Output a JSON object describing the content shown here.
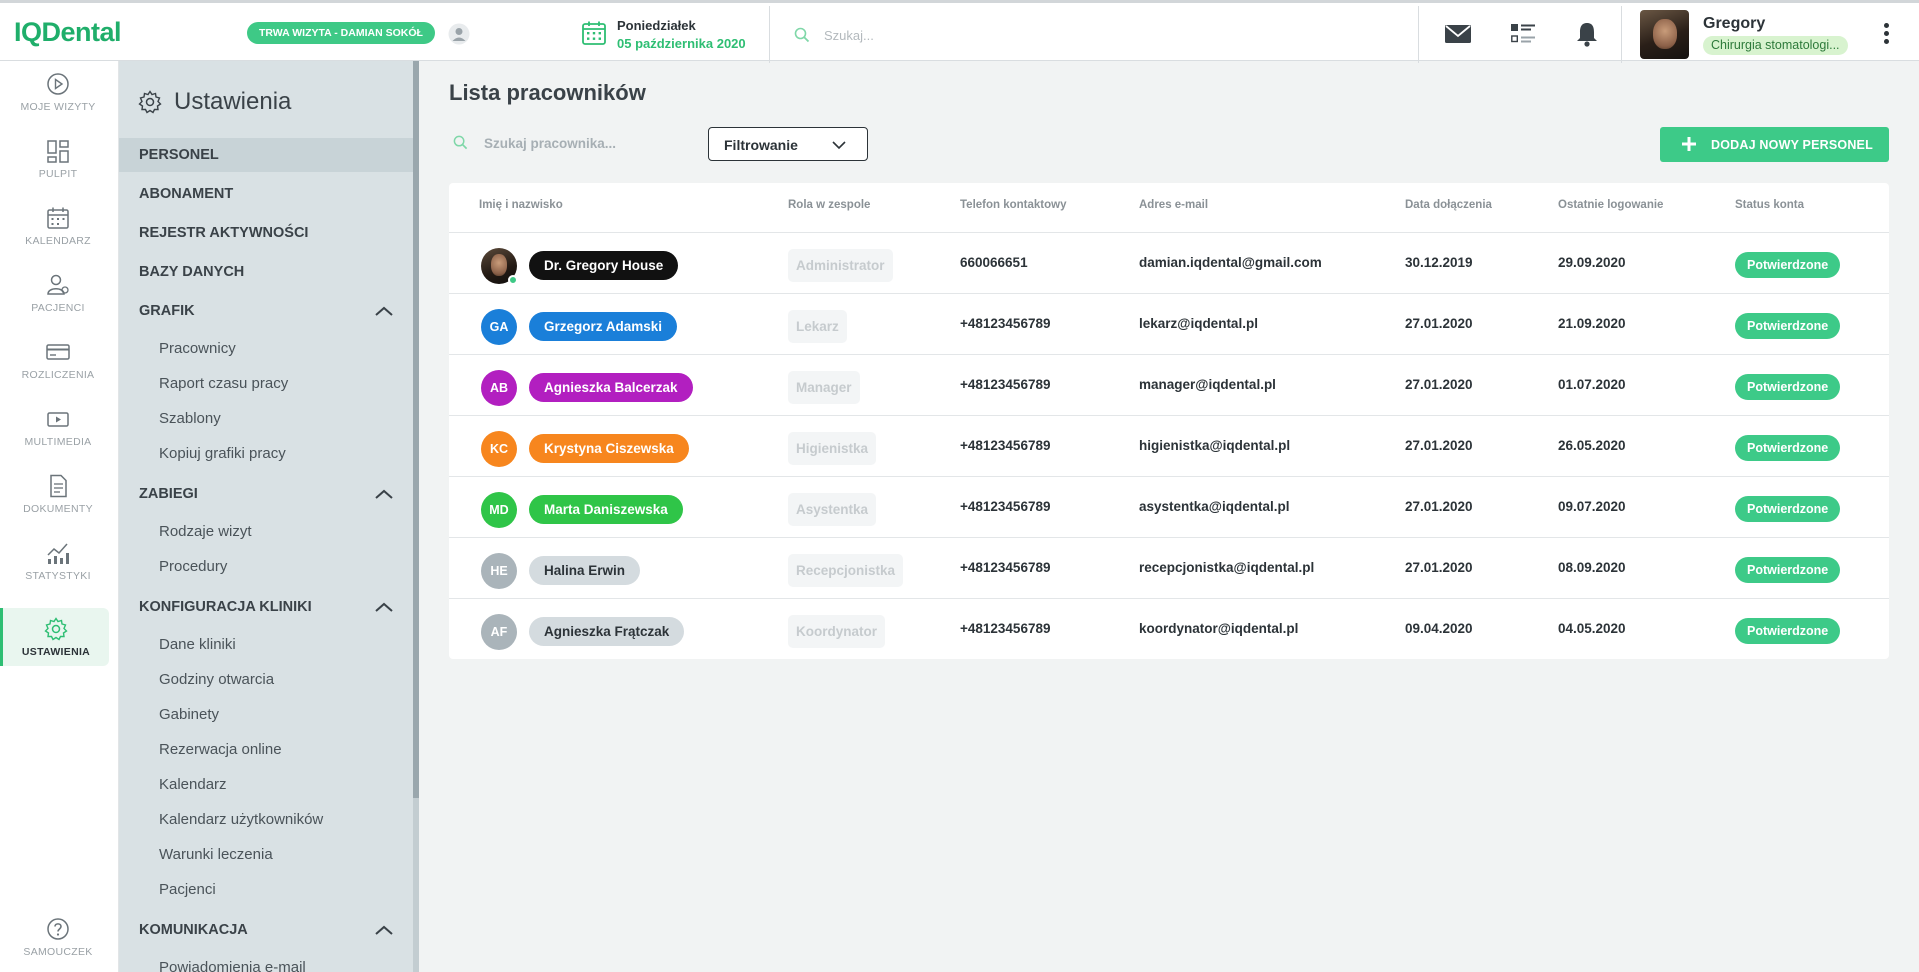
{
  "app": {
    "logo": "IQDental",
    "visit_badge": "TRWA WIZYTA - DAMIAN SOKÓŁ",
    "day_name": "Poniedziałek",
    "date": "05 października 2020",
    "search_placeholder": "Szukaj...",
    "user_name": "Gregory",
    "user_role": "Chirurgia stomatologi..."
  },
  "rail": {
    "items": [
      {
        "label": "MOJE WIZYTY",
        "icon": "play-circle-icon"
      },
      {
        "label": "PULPIT",
        "icon": "dashboard-icon"
      },
      {
        "label": "KALENDARZ",
        "icon": "calendar-icon"
      },
      {
        "label": "PACJENCI",
        "icon": "patients-icon"
      },
      {
        "label": "ROZLICZENIA",
        "icon": "credit-card-icon"
      },
      {
        "label": "MULTIMEDIA",
        "icon": "media-icon"
      },
      {
        "label": "DOKUMENTY",
        "icon": "document-icon"
      },
      {
        "label": "STATYSTYKI",
        "icon": "stats-icon"
      },
      {
        "label": "USTAWIENIA",
        "icon": "gear-icon",
        "active": true
      }
    ],
    "help_label": "SAMOUCZEK"
  },
  "settings": {
    "title": "Ustawienia",
    "sections": {
      "personel": "PERSONEL",
      "abonament": "ABONAMENT",
      "rejestr": "REJESTR AKTYWNOŚCI",
      "bazy": "BAZY DANYCH",
      "grafik": "GRAFIK",
      "zabiegi": "ZABIEGI",
      "konfiguracja": "KONFIGURACJA KLINIKI",
      "komunikacja": "KOMUNIKACJA"
    },
    "grafik_items": [
      "Pracownicy",
      "Raport czasu pracy",
      "Szablony",
      "Kopiuj grafiki pracy"
    ],
    "zabiegi_items": [
      "Rodzaje wizyt",
      "Procedury"
    ],
    "konfiguracja_items": [
      "Dane kliniki",
      "Godziny otwarcia",
      "Gabinety",
      "Rezerwacja online",
      "Kalendarz",
      "Kalendarz użytkowników",
      "Warunki leczenia",
      "Pacjenci"
    ],
    "komunikacja_items": [
      "Powiadomienia e-mail"
    ]
  },
  "main": {
    "title": "Lista pracowników",
    "search_placeholder": "Szukaj pracownika...",
    "filter_label": "Filtrowanie",
    "add_button": "DODAJ NOWY PERSONEL",
    "columns": {
      "name": "Imię i nazwisko",
      "role": "Rola w zespole",
      "phone": "Telefon kontaktowy",
      "email": "Adres e-mail",
      "joined": "Data dołączenia",
      "last_login": "Ostatnie logowanie",
      "status": "Status konta"
    },
    "rows": [
      {
        "initials": "",
        "name": "Dr. Gregory House",
        "role": "Administrator",
        "phone": "660066651",
        "email": "damian.iqdental@gmail.com",
        "joined": "30.12.2019",
        "last_login": "29.09.2020",
        "status": "Potwierdzone",
        "color": "#111111",
        "text_color": "#ffffff"
      },
      {
        "initials": "GA",
        "name": "Grzegorz Adamski",
        "role": "Lekarz",
        "phone": "+48123456789",
        "email": "lekarz@iqdental.pl",
        "joined": "27.01.2020",
        "last_login": "21.09.2020",
        "status": "Potwierdzone",
        "color": "#1a7fd9",
        "text_color": "#ffffff"
      },
      {
        "initials": "AB",
        "name": "Agnieszka Balcerzak",
        "role": "Manager",
        "phone": "+48123456789",
        "email": "manager@iqdental.pl",
        "joined": "27.01.2020",
        "last_login": "01.07.2020",
        "status": "Potwierdzone",
        "color": "#b21fc0",
        "text_color": "#ffffff"
      },
      {
        "initials": "KC",
        "name": "Krystyna Ciszewska",
        "role": "Higienistka",
        "phone": "+48123456789",
        "email": "higienistka@iqdental.pl",
        "joined": "27.01.2020",
        "last_login": "26.05.2020",
        "status": "Potwierdzone",
        "color": "#f7861e",
        "text_color": "#ffffff"
      },
      {
        "initials": "MD",
        "name": "Marta Daniszewska",
        "role": "Asystentka",
        "phone": "+48123456789",
        "email": "asystentka@iqdental.pl",
        "joined": "27.01.2020",
        "last_login": "09.07.2020",
        "status": "Potwierdzone",
        "color": "#2fc548",
        "text_color": "#ffffff"
      },
      {
        "initials": "HE",
        "name": "Halina Erwin",
        "role": "Recepcjonistka",
        "phone": "+48123456789",
        "email": "recepcjonistka@iqdental.pl",
        "joined": "27.01.2020",
        "last_login": "08.09.2020",
        "status": "Potwierdzone",
        "color": "#d4dbdf",
        "text_color": "#2c3338",
        "avatar_color": "#aab4ba"
      },
      {
        "initials": "AF",
        "name": "Agnieszka Frątczak",
        "role": "Koordynator",
        "phone": "+48123456789",
        "email": "koordynator@iqdental.pl",
        "joined": "09.04.2020",
        "last_login": "04.05.2020",
        "status": "Potwierdzone",
        "color": "#d4dbdf",
        "text_color": "#2c3338",
        "avatar_color": "#aab4ba"
      }
    ]
  },
  "colors": {
    "accent": "#3dca88",
    "brand": "#1fae6a"
  }
}
